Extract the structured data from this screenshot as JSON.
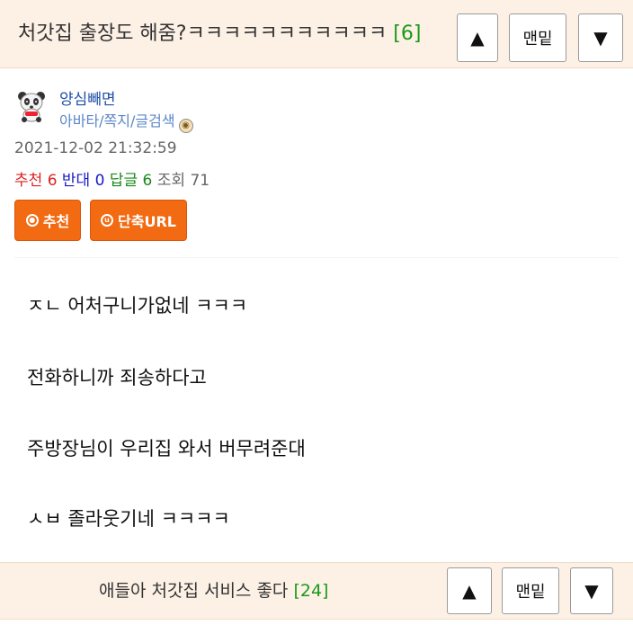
{
  "top_bar": {
    "title": "처갓집 출장도 해줌?ㅋㅋㅋㅋㅋㅋㅋㅋㅋㅋㅋ",
    "comment_count": "[6]",
    "up_icon": "▲",
    "bottom_label": "맨밑",
    "down_icon": "▼"
  },
  "author": {
    "avatar_icon": "panda-avatar-icon",
    "nickname": "양심빼면",
    "links": "아바타/쪽지/글검색"
  },
  "meta": {
    "datetime": "2021-12-02 21:32:59",
    "recommend_label": "추천",
    "recommend_count": "6",
    "oppose_label": "반대",
    "oppose_count": "0",
    "reply_label": "답글",
    "reply_count": "6",
    "views_label": "조회",
    "views_count": "71"
  },
  "actions": {
    "recommend_button": "추천",
    "short_url_button": "단축URL"
  },
  "body": {
    "lines": [
      "ㅈㄴ 어처구니가없네 ㅋㅋㅋ",
      "전화하니까 죄송하다고",
      "주방장님이 우리집 와서 버무려준대",
      "ㅅㅂ 졸라웃기네 ㅋㅋㅋㅋ"
    ]
  },
  "bottom_bar": {
    "title": "애들아 처갓집 서비스 좋다",
    "comment_count": "[24]",
    "up_icon": "▲",
    "bottom_label": "맨밑",
    "down_icon": "▼"
  },
  "colors": {
    "bar_bg": "#fdf1e6",
    "accent_orange": "#f26a12",
    "count_green": "#1a9a1a",
    "nick_blue": "#1f4fa8"
  }
}
